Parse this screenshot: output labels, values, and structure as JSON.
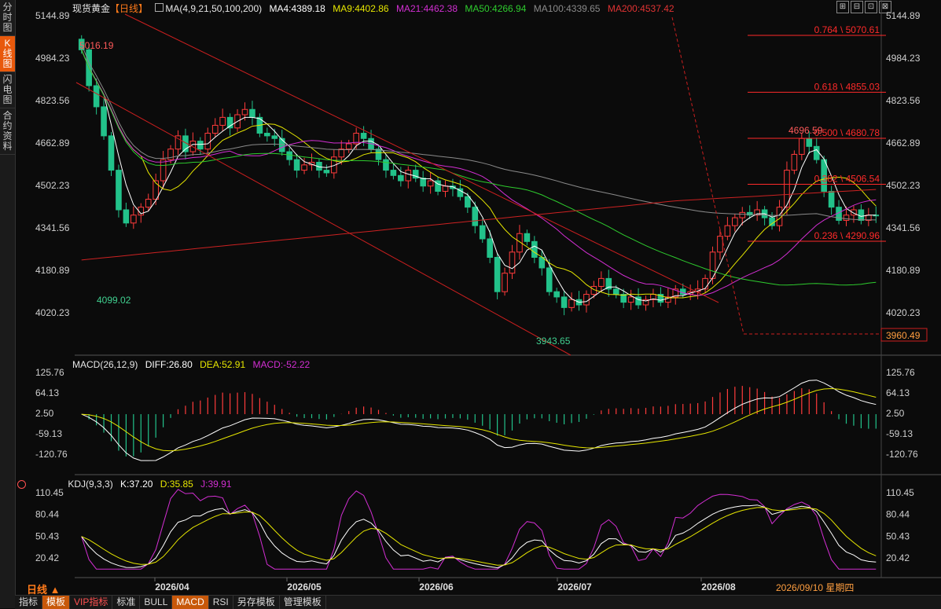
{
  "sidebar": {
    "tabs": [
      {
        "label": "分时图",
        "active": false
      },
      {
        "label": "K线图",
        "active": true
      },
      {
        "label": "闪电图",
        "active": false
      },
      {
        "label": "合约资料",
        "active": false
      }
    ]
  },
  "header": {
    "title": "现货黄金",
    "period": "【日线】",
    "ma_params": "MA(4,9,21,50,100,200)",
    "ma4": "MA4:4389.18",
    "ma9": "MA9:4402.86",
    "ma21": "MA21:4462.38",
    "ma50": "MA50:4266.94",
    "ma100": "MA100:4339.65",
    "ma200": "MA200:4537.42"
  },
  "colors": {
    "up": "#ff3b3b",
    "down": "#22c28a",
    "ma4": "#ffffff",
    "ma9": "#e6e600",
    "ma21": "#d22ed2",
    "ma50": "#2ecc2e",
    "ma100": "#8a8a8a",
    "ma200": "#cc2222",
    "fib": "#ff2a2a",
    "macd_dea": "#e6e600",
    "kdj_d": "#e6e600",
    "kdj_j": "#d22ed2",
    "accent": "#e8590c"
  },
  "price_axis": [
    "5144.89",
    "4984.23",
    "4823.56",
    "4662.89",
    "4502.23",
    "4341.56",
    "4180.89",
    "4020.23"
  ],
  "last_price_tag": "3960.49",
  "annotations": {
    "high_left": "5016.19",
    "low_left": "4099.02",
    "low_mid": "3943.65",
    "high_right": "4696.59"
  },
  "fib_levels": [
    {
      "label": "0.764 \\ 5070.61",
      "price": 5070.61
    },
    {
      "label": "0.618 \\ 4855.03",
      "price": 4855.03
    },
    {
      "label": "0.500 \\ 4680.78",
      "price": 4680.78
    },
    {
      "label": "0.382 \\ 4506.54",
      "price": 4506.54
    },
    {
      "label": "0.236 \\ 4290.96",
      "price": 4290.96
    }
  ],
  "macd": {
    "legend": "MACD(26,12,9)",
    "diff": "DIFF:26.80",
    "dea": "DEA:52.91",
    "macd": "MACD:-52.22",
    "axis": [
      "125.76",
      "64.13",
      "2.50",
      "-59.13",
      "-120.76"
    ]
  },
  "kdj": {
    "legend": "KDJ(9,3,3)",
    "k": "K:37.20",
    "d": "D:35.85",
    "j": "J:39.91",
    "axis": [
      "110.45",
      "80.44",
      "50.43",
      "20.42"
    ]
  },
  "x_axis": [
    "2026/04",
    "2026/05",
    "2026/06",
    "2026/07",
    "2026/08"
  ],
  "cursor_date": "2026/09/10 星期四",
  "period_label": "日线 ▲",
  "bottom_tabs": [
    "指标",
    "模板",
    "VIP指标",
    "标准",
    "BULL",
    "MACD",
    "RSI",
    "另存模板",
    "管理模板"
  ],
  "window_controls": [
    "⊞",
    "⊟",
    "⊡",
    "⊠"
  ],
  "chart_data": {
    "type": "candlestick",
    "ylim": [
      3920,
      5150
    ],
    "closes": [
      5016,
      4880,
      4800,
      4690,
      4560,
      4410,
      4360,
      4390,
      4420,
      4450,
      4520,
      4600,
      4640,
      4690,
      4630,
      4670,
      4640,
      4700,
      4730,
      4760,
      4720,
      4770,
      4790,
      4760,
      4700,
      4690,
      4680,
      4630,
      4600,
      4560,
      4580,
      4590,
      4560,
      4550,
      4610,
      4640,
      4660,
      4700,
      4680,
      4640,
      4600,
      4560,
      4540,
      4520,
      4560,
      4530,
      4500,
      4520,
      4480,
      4500,
      4490,
      4460,
      4420,
      4350,
      4300,
      4230,
      4100,
      4170,
      4250,
      4320,
      4290,
      4230,
      4190,
      4100,
      4080,
      4040,
      4070,
      4050,
      4090,
      4120,
      4150,
      4110,
      4090,
      4060,
      4080,
      4050,
      4070,
      4090,
      4060,
      4080,
      4110,
      4090,
      4100,
      4110,
      4150,
      4250,
      4310,
      4350,
      4380,
      4400,
      4390,
      4410,
      4380,
      4350,
      4420,
      4560,
      4620,
      4680,
      4650,
      4600,
      4480,
      4420,
      4370,
      4390,
      4410,
      4370,
      4390,
      4389
    ]
  }
}
